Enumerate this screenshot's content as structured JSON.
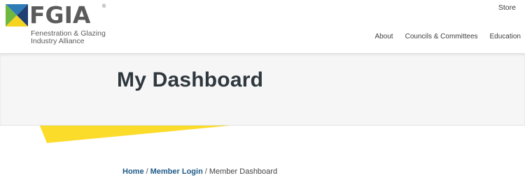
{
  "brand": {
    "wordmark": "FGIA",
    "registered": "®",
    "tagline": "Fenestration & Glazing Industry Alliance",
    "colors": {
      "green": "#6fb83f",
      "blue": "#2e7cb6",
      "navy": "#1f3f73",
      "yellow": "#f4d41f",
      "text_gray": "#5b5b5b"
    }
  },
  "header": {
    "utility_link": "Store",
    "nav": [
      {
        "label": "About"
      },
      {
        "label": "Councils & Committees"
      },
      {
        "label": "Education"
      }
    ]
  },
  "hero": {
    "title": "My Dashboard",
    "accent_color": "#fcdc2a"
  },
  "breadcrumb": {
    "home": "Home",
    "separator": "/",
    "parent": "Member Login",
    "current": "Member Dashboard"
  }
}
